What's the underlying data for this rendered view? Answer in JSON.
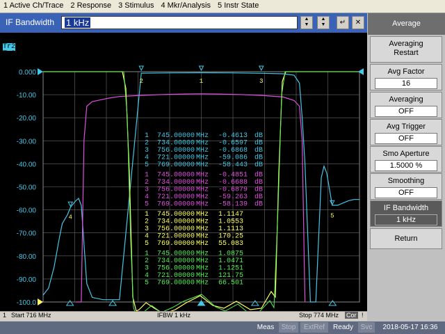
{
  "menu": [
    "1 Active Ch/Trace",
    "2 Response",
    "3 Stimulus",
    "4 Mkr/Analysis",
    "5 Instr State"
  ],
  "entry": {
    "label": "IF Bandwidth",
    "value": "1 kHz"
  },
  "traces": [
    {
      "text": "Tr1  S11  SWR 100.0m/ Ref 1.000  [F2]",
      "color": "#ffff66"
    },
    {
      "text": "S21  Log Mag 10.00dB/ Ref 0.000dB  [F2]",
      "color": "#44c8e8",
      "tag": "Tr2"
    },
    {
      "text": "Tr3  S12  Log Mag 600.0mdB/ Ref 0.000dB  [F2]",
      "color": "#e050e0"
    },
    {
      "text": "Tr4  S22  SWR 100.0m/ Ref 1.000  [F2]",
      "color": "#55ee55"
    }
  ],
  "y_ticks": [
    "0.000",
    "-10.00",
    "-20.00",
    "-30.00",
    "-40.00",
    "-50.00",
    "-60.00",
    "-70.00",
    "-80.00",
    "-90.00",
    "-100.0"
  ],
  "marker_tables": [
    {
      "color": "#44c8e8",
      "rows": [
        {
          "n": "1",
          "f": "745.00000",
          "u": "MHz",
          "v": "-0.4613",
          "unit": "dB"
        },
        {
          "n": "2",
          "f": "734.00000",
          "u": "MHz",
          "v": "-0.6597",
          "unit": "dB"
        },
        {
          "n": "3",
          "f": "756.00000",
          "u": "MHz",
          "v": "-0.6868",
          "unit": "dB"
        },
        {
          "n": "4",
          "f": "721.00000",
          "u": "MHz",
          "v": "-59.086",
          "unit": "dB"
        },
        {
          "n": "5",
          "f": "769.00000",
          "u": "MHz",
          "v": "-58.443",
          "unit": "dB"
        }
      ]
    },
    {
      "color": "#e050e0",
      "rows": [
        {
          "n": "1",
          "f": "745.00000",
          "u": "MHz",
          "v": "-0.4851",
          "unit": "dB"
        },
        {
          "n": "2",
          "f": "734.00000",
          "u": "MHz",
          "v": "-0.6688",
          "unit": "dB"
        },
        {
          "n": "3",
          "f": "756.00000",
          "u": "MHz",
          "v": "-0.6879",
          "unit": "dB"
        },
        {
          "n": "4",
          "f": "721.00000",
          "u": "MHz",
          "v": "-59.263",
          "unit": "dB"
        },
        {
          "n": "5",
          "f": "769.00000",
          "u": "MHz",
          "v": "-58.139",
          "unit": "dB"
        }
      ]
    },
    {
      "color": "#ffff66",
      "rows": [
        {
          "n": "1",
          "f": "745.00000",
          "u": "MHz",
          "v": "1.1147",
          "unit": ""
        },
        {
          "n": "2",
          "f": "734.00000",
          "u": "MHz",
          "v": "1.0553",
          "unit": ""
        },
        {
          "n": "3",
          "f": "756.00000",
          "u": "MHz",
          "v": "1.1113",
          "unit": ""
        },
        {
          "n": "4",
          "f": "721.00000",
          "u": "MHz",
          "v": "170.25",
          "unit": ""
        },
        {
          "n": "5",
          "f": "769.00000",
          "u": "MHz",
          "v": "55.083",
          "unit": ""
        }
      ]
    },
    {
      "color": "#55ee55",
      "rows": [
        {
          "n": "1",
          "f": "745.00000",
          "u": "MHz",
          "v": "1.0875",
          "unit": ""
        },
        {
          "n": "2",
          "f": "734.00000",
          "u": "MHz",
          "v": "1.0471",
          "unit": ""
        },
        {
          "n": "3",
          "f": "756.00000",
          "u": "MHz",
          "v": "1.1251",
          "unit": ""
        },
        {
          "n": "4",
          "f": "721.00000",
          "u": "MHz",
          "v": "121.75",
          "unit": ""
        },
        {
          "n": "5",
          "f": "769.00000",
          "u": "MHz",
          "v": "66.501",
          "unit": ""
        }
      ]
    }
  ],
  "sidebar": {
    "title": "Average",
    "buttons": [
      {
        "label": "Averaging",
        "label2": "Restart"
      },
      {
        "label": "Avg Factor",
        "value": "16"
      },
      {
        "label": "Averaging",
        "value": "OFF"
      },
      {
        "label": "Avg Trigger",
        "value": "OFF"
      },
      {
        "label": "Smo Aperture",
        "value": "1.5000  %"
      },
      {
        "label": "Smoothing",
        "value": "OFF"
      },
      {
        "label": "IF Bandwidth",
        "value": "1 kHz"
      },
      {
        "label": "Return"
      }
    ]
  },
  "status": {
    "channel": "1",
    "start": "Start 716 MHz",
    "ifbw": "IFBW 1 kHz",
    "stop": "Stop 774 MHz",
    "cor": "Cor",
    "bang": "!"
  },
  "footer": {
    "meas": "Meas",
    "stop": "Stop",
    "extref": "ExtRef",
    "ready": "Ready",
    "svc": "Svc",
    "datetime": "2018-05-17 16:36"
  },
  "chart_data": {
    "type": "line",
    "x_range_mhz": [
      716,
      774
    ],
    "ylim": [
      -100,
      0
    ],
    "grid": true,
    "series": [
      {
        "color": "#44c8e8",
        "x": [
          716,
          717,
          718,
          719,
          719.5,
          720,
          720.5,
          721,
          721.3,
          722,
          722.5,
          723,
          724,
          725,
          727,
          730,
          734,
          740,
          745,
          750,
          756,
          760,
          762,
          763,
          763.5,
          764,
          765,
          766,
          767,
          767.5,
          768,
          769,
          770,
          771,
          772,
          773,
          774
        ],
        "y": [
          -97,
          -94,
          -85,
          -72,
          -66,
          -64,
          -62,
          -59,
          -58,
          -56,
          -55,
          -58,
          -92,
          -98,
          -99,
          -99,
          -0.66,
          -0.5,
          -0.46,
          -0.5,
          -0.69,
          -0.9,
          -1.5,
          -5,
          -20,
          -40,
          -100,
          -100,
          -46,
          -41,
          -44,
          -58,
          -58,
          -57,
          -56,
          -55.5,
          -55.5
        ]
      },
      {
        "color": "#e050e0",
        "x": [
          722,
          723,
          723.5,
          724,
          725,
          728,
          730,
          734,
          738,
          742,
          745,
          748,
          752,
          756,
          760,
          762,
          763,
          763.5,
          764
        ],
        "y": [
          -100,
          -100,
          -30,
          -15,
          -13,
          -11.5,
          -10.8,
          -10.3,
          -9.9,
          -9.7,
          -9.6,
          -9.7,
          -9.9,
          -10.3,
          -11,
          -12.5,
          -15,
          -30,
          -100
        ]
      }
    ]
  }
}
